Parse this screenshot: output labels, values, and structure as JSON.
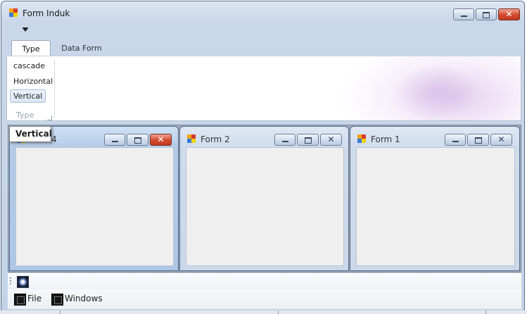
{
  "window": {
    "title": "Form Induk"
  },
  "ribbon": {
    "tabs": [
      {
        "label": "Type",
        "active": true
      },
      {
        "label": "Data Form",
        "active": false
      }
    ],
    "group": {
      "label": "Type",
      "items": [
        {
          "label": "cascade",
          "selected": false
        },
        {
          "label": "Horizontal",
          "selected": false
        },
        {
          "label": "Vertical",
          "selected": true
        }
      ]
    },
    "tooltip": "Vertical"
  },
  "children": [
    {
      "title": "Form 4",
      "title_visible": "4",
      "active": true
    },
    {
      "title": "Form 2",
      "active": false
    },
    {
      "title": "Form 1",
      "active": false
    }
  ],
  "bottom_menu": {
    "items": [
      {
        "label": "File",
        "icon": "file-icon"
      },
      {
        "label": "Windows",
        "icon": "windows-icon"
      }
    ]
  },
  "colors": {
    "titlebar": "#c9d7ea",
    "close_button": "#d3492f",
    "mdi_background": "#9eacc0",
    "child_client": "#efefef"
  }
}
